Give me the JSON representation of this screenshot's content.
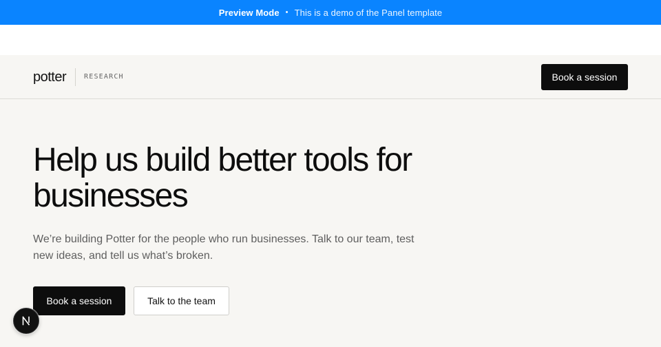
{
  "banner": {
    "mode": "Preview Mode",
    "separator": "•",
    "description": "This is a demo of the Panel template"
  },
  "header": {
    "brand": "potter",
    "brand_sub": "RESEARCH",
    "cta_label": "Book a session"
  },
  "hero": {
    "title": "Help us build better tools for businesses",
    "subtitle": "We’re building Potter for the people who run businesses. Talk to our team, test new ideas, and tell us what’s broken.",
    "primary_cta": "Book a session",
    "secondary_cta": "Talk to the team"
  },
  "fab": {
    "icon": "nextjs-logo-icon"
  },
  "colors": {
    "banner_bg": "#0a84ff",
    "page_bg": "#f7f6f3",
    "primary_button": "#0d0d0d"
  }
}
